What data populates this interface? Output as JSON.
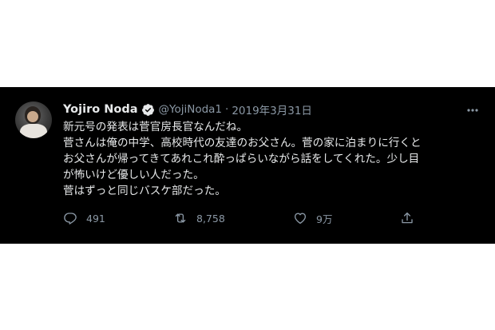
{
  "tweet": {
    "display_name": "Yojiro Noda",
    "handle": "@YojiNoda1",
    "separator": "·",
    "date": "2019年3月31日",
    "lines": [
      "新元号の発表は菅官房長官なんだね。",
      "菅さんは俺の中学、高校時代の友達のお父さん。菅の家に泊まりに行くと",
      "お父さんが帰ってきてあれこれ酔っぱらいながら話をしてくれた。少し目",
      "が怖いけど優しい人だった。",
      "菅はずっと同じバスケ部だった。"
    ],
    "counts": {
      "replies": "491",
      "retweets": "8,758",
      "likes": "9万"
    }
  },
  "icons": {
    "avatar": "user-avatar",
    "verified": "verified-badge-icon",
    "more": "more-options-icon",
    "reply": "reply-icon",
    "retweet": "retweet-icon",
    "like": "heart-icon",
    "share": "share-icon"
  },
  "colors": {
    "card_background": "#000000",
    "page_background": "#ffffff",
    "primary_text": "#e7e9ea",
    "secondary_text": "#8b98a5"
  }
}
